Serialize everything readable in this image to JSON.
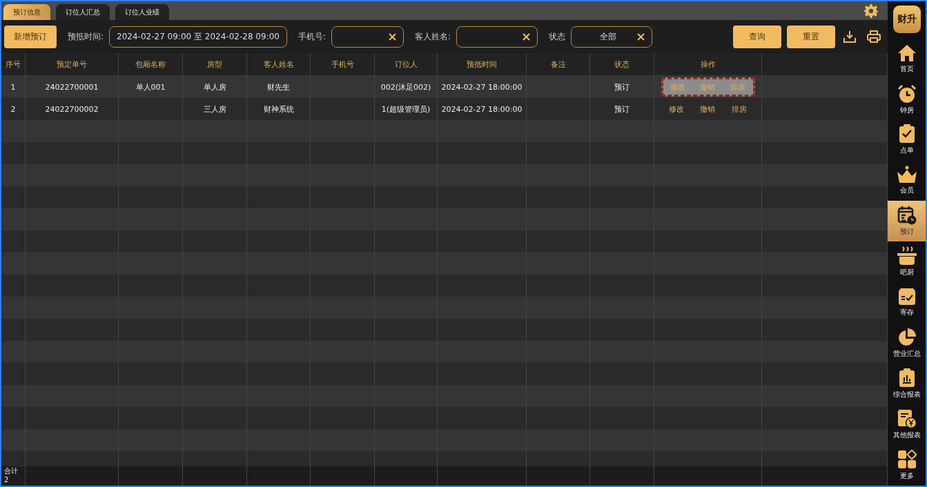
{
  "tabs": [
    {
      "label": "预订信息",
      "selected": true
    },
    {
      "label": "订位人汇总",
      "selected": false
    },
    {
      "label": "订位人业绩",
      "selected": false
    }
  ],
  "toolbar": {
    "add_button": "新增预订",
    "filters": [
      {
        "label": "预抵时间:",
        "value": "2024-02-27 09:00 至 2024-02-28 09:00",
        "clearable": false
      },
      {
        "label": "手机号:",
        "clearable": true
      },
      {
        "label": "客人姓名:",
        "clearable": true
      },
      {
        "label": "状态",
        "value": "全部",
        "clearable": true
      }
    ],
    "buttons": [
      "查询",
      "重置"
    ]
  },
  "table": {
    "columns": [
      "序号",
      "预定单号",
      "包厢名称",
      "房型",
      "客人姓名",
      "手机号",
      "订位人",
      "预抵时间",
      "备注",
      "状态",
      "操作"
    ],
    "rows": [
      {
        "cells": [
          "1",
          "24022700001",
          "单人001",
          "单人房",
          "财先生",
          "",
          "002(沐足002)",
          "2024-02-27 18:00:00",
          "",
          "预订"
        ],
        "actions": [
          "修改",
          "撤销",
          "排房"
        ],
        "focused": true
      },
      {
        "cells": [
          "2",
          "24022700002",
          "",
          "三人房",
          "财神系统",
          "",
          "1(超级管理员)",
          "2024-02-27 18:00:00",
          "",
          "预订"
        ],
        "actions": [
          "修改",
          "撤销",
          "排房"
        ],
        "focused": false
      }
    ],
    "footer": {
      "label": "合计",
      "count": "2"
    }
  },
  "sidebar": {
    "logo": "财升",
    "items": [
      {
        "label": "首页",
        "selected": false
      },
      {
        "label": "钟房",
        "selected": false
      },
      {
        "label": "点单",
        "selected": false
      },
      {
        "label": "会员",
        "selected": false
      },
      {
        "label": "预订",
        "selected": true
      },
      {
        "label": "吧厨",
        "selected": false
      },
      {
        "label": "寄存",
        "selected": false
      },
      {
        "label": "营业汇总",
        "selected": false
      },
      {
        "label": "综合报表",
        "selected": false
      },
      {
        "label": "其他报表",
        "selected": false
      },
      {
        "label": "更多",
        "selected": false
      }
    ]
  }
}
